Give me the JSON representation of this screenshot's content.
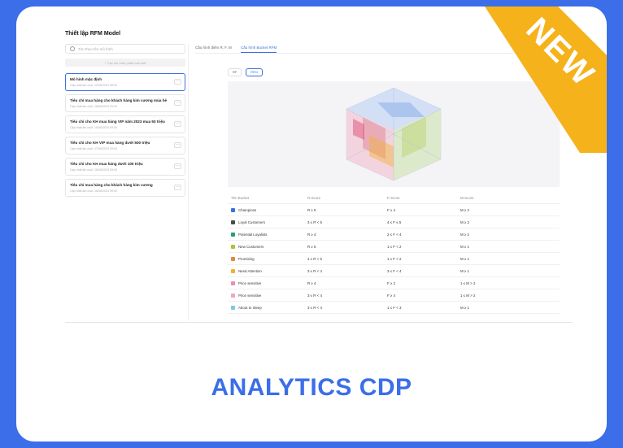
{
  "app": {
    "title": "Thiết lập RFM Model",
    "search_placeholder": "Tìm theo tên mô hình",
    "add_label": "+ Tạo mô hình phân loại mới",
    "models": [
      {
        "title": "Mô hình mặc định",
        "subtitle": "Cập nhật lần cuối: 12/06/2023 08:00",
        "active": true
      },
      {
        "title": "Tiêu chí mua hàng cho khách hàng kim cương mùa hè",
        "subtitle": "Cập nhật lần cuối: 18/06/2023 20:00",
        "active": false
      },
      {
        "title": "Tiêu chí cho KH mua hàng VIP năm 2023 mua 50 triệu",
        "subtitle": "Cập nhật lần cuối: 18/06/2023 09:00",
        "active": false
      },
      {
        "title": "Tiêu chí cho KH VIP mua hàng dưới 500 triệu",
        "subtitle": "Cập nhật lần cuối: 17/06/2023 09:00",
        "active": false
      },
      {
        "title": "Tiêu chí cho KH mua hàng dưới 100 triệu",
        "subtitle": "Cập nhật lần cuối: 16/06/2023 09:00",
        "active": false
      },
      {
        "title": "Tiêu chí mua hàng cho khách hàng kim cương",
        "subtitle": "Cập nhật lần cuối: 16/06/2023 09:00",
        "active": false
      }
    ],
    "tabs": [
      "Cấu hình điểm R, F, M",
      "Cấu hình Bucket RFM"
    ],
    "active_tab": 1,
    "pills": [
      "RF",
      "RFM"
    ],
    "active_pill": 1,
    "table": {
      "headers": [
        "Tên Bucket",
        "R-Score",
        "F-Score",
        "M-Score"
      ],
      "rows": [
        {
          "name": "Champions",
          "r": "R ≥ 5",
          "f": "F ≥ 4",
          "m": "M ≥ 2",
          "color": "#3b6ee8"
        },
        {
          "name": "Loyal Customers",
          "r": "3 ≤ R < 5",
          "f": "4 ≤ F ≤ 5",
          "m": "M ≥ 2",
          "color": "#4a4a4a"
        },
        {
          "name": "Potential Loyalists",
          "r": "R ≥ 4",
          "f": "2 ≤ F < 4",
          "m": "M ≥ 2",
          "color": "#21a36b"
        },
        {
          "name": "New Customers",
          "r": "R ≥ 5",
          "f": "1 ≤ F < 2",
          "m": "M ≥ 1",
          "color": "#a4c639"
        },
        {
          "name": "Promising",
          "r": "4 ≤ R < 5",
          "f": "1 ≤ F < 2",
          "m": "M ≥ 1",
          "color": "#e08a3c"
        },
        {
          "name": "Need Attention",
          "r": "3 ≤ R < 4",
          "f": "3 ≤ F < 4",
          "m": "M ≥ 1",
          "color": "#f2b134"
        },
        {
          "name": "Price sensitive",
          "r": "R ≥ 4",
          "f": "F ≥ 2",
          "m": "1 ≤ M > 2",
          "color": "#f08cb4"
        },
        {
          "name": "Price sensitive",
          "r": "3 ≤ R < 4",
          "f": "F ≥ 4",
          "m": "1 ≤ M > 2",
          "color": "#f5a3c7"
        },
        {
          "name": "About to Sleep",
          "r": "3 ≤ R < 4",
          "f": "1 ≤ F < 3",
          "m": "M ≥ 1",
          "color": "#7ec8e3"
        }
      ]
    }
  },
  "ribbon_label": "NEW",
  "ribbon_color": "#f6b21b",
  "caption": "ANALYTICS CDP",
  "accent_color": "#3b6ee8"
}
